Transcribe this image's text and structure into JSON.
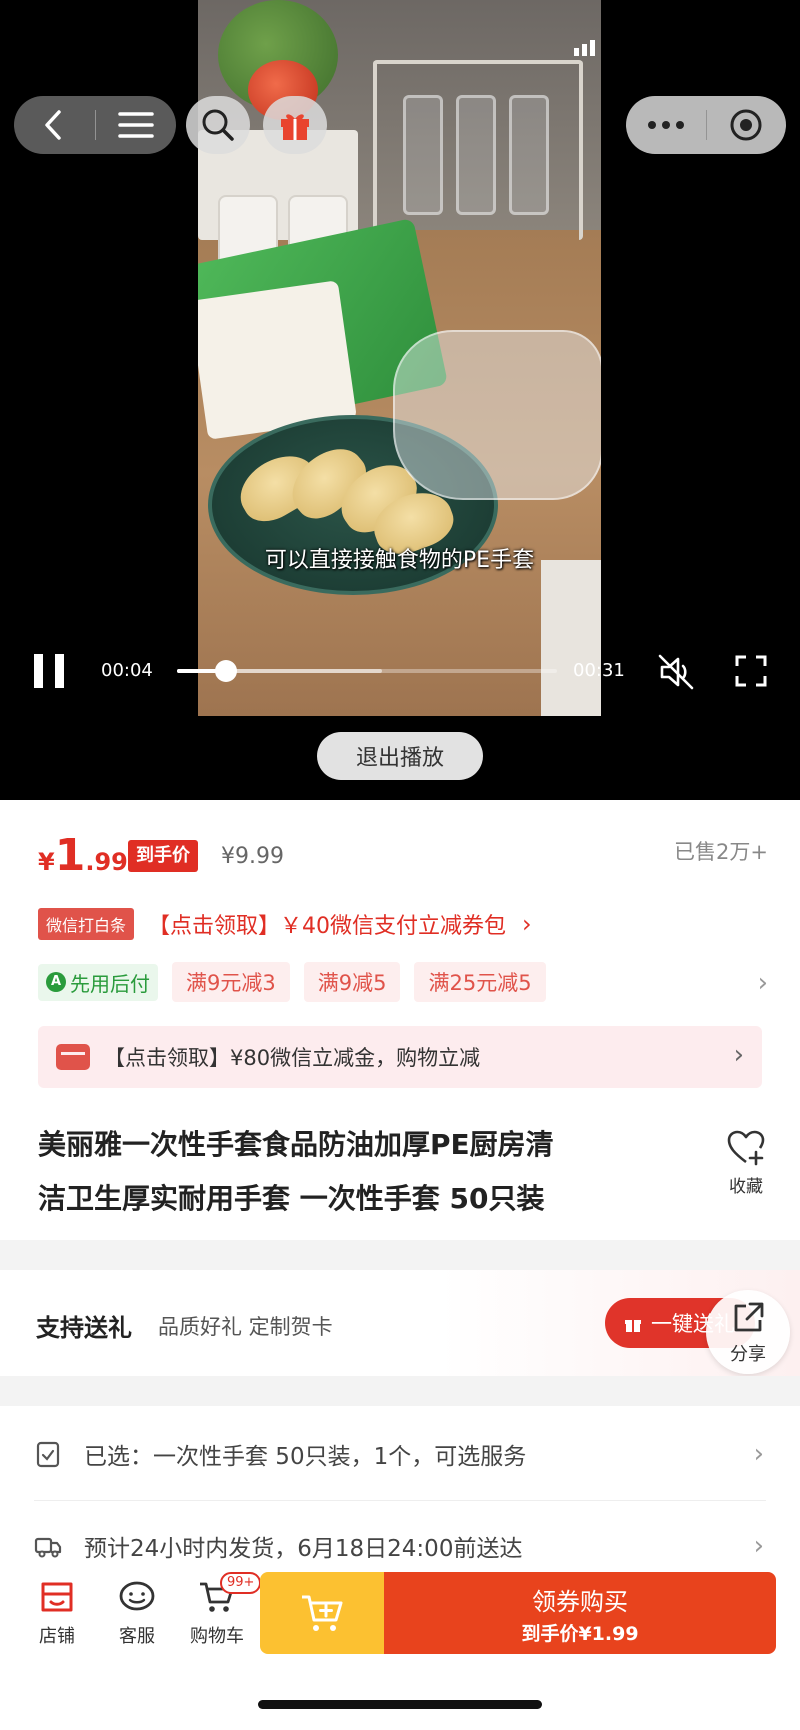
{
  "video": {
    "subtitle": "可以直接接触食物的PE手套",
    "current_time": "00:04",
    "total_time": "00:31",
    "progress": 0.129,
    "buffered": 0.54,
    "exit_label": "退出播放"
  },
  "product": {
    "price_yen": "¥",
    "price_int": "1",
    "price_dec": ".99",
    "price_tag": "到手价",
    "original_price": "¥9.99",
    "sold": "已售2万+",
    "coupon_tag": "微信打白条",
    "coupon_text": "【点击领取】￥40微信支付立减券包",
    "coupon_arrow": "›",
    "pay_later": "先用后付",
    "pay_later_icon": "A",
    "promos": [
      "满9元减3",
      "满9减5",
      "满25元减5"
    ],
    "banner_text": "【点击领取】¥80微信立减金，购物立减",
    "title_lines": [
      "美丽雅一次性手套食品防油加厚PE厨房清",
      "洁卫生厚实耐用手套 一次性手套 50只装"
    ],
    "favorite_label": "收藏"
  },
  "gift": {
    "title": "支持送礼",
    "subtitle": "品质好礼 定制贺卡",
    "button": "一键送礼",
    "share_label": "分享"
  },
  "selection": {
    "selected": "已选：一次性手套 50只装，1个，可选服务",
    "delivery": "预计24小时内发货，6月18日24:00前送达"
  },
  "bottom": {
    "shop": "店铺",
    "service": "客服",
    "cart": "购物车",
    "cart_badge": "99+",
    "buy_main": "领券购买",
    "buy_sub": "到手价¥1.99"
  },
  "colors": {
    "accent": "#e02e24",
    "buy": "#e8431d",
    "add_cart": "#fcc131",
    "pay_later": "#2a9b3c"
  }
}
